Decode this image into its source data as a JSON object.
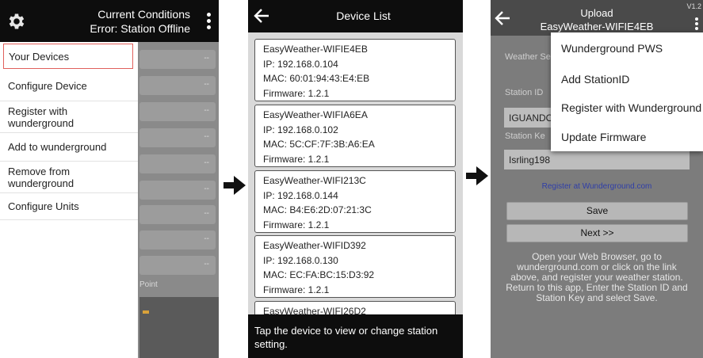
{
  "screen1": {
    "title_line1": "Current Conditions",
    "title_line2": "Error: Station Offline",
    "icons": [
      "gear-icon",
      "kebab-menu-icon"
    ],
    "drawer": {
      "items": [
        {
          "label": "Your Devices",
          "selected": true
        },
        {
          "label": "Configure Device",
          "selected": false
        },
        {
          "label": "Register with wunderground",
          "selected": false
        },
        {
          "label": "Add to wunderground",
          "selected": false
        },
        {
          "label": "Remove from wunderground",
          "selected": false
        },
        {
          "label": "Configure Units",
          "selected": false
        }
      ]
    },
    "background": {
      "row_value": "--",
      "partial_text": "Point"
    }
  },
  "screen2": {
    "title": "Device List",
    "icons": [
      "back-arrow-icon"
    ],
    "devices": [
      {
        "name": "EasyWeather-WIFIE4EB",
        "ip": "IP: 192.168.0.104",
        "mac": "MAC: 60:01:94:43:E4:EB",
        "firmware": "Firmware: 1.2.1"
      },
      {
        "name": "EasyWeather-WIFIA6EA",
        "ip": "IP: 192.168.0.102",
        "mac": "MAC: 5C:CF:7F:3B:A6:EA",
        "firmware": "Firmware: 1.2.1"
      },
      {
        "name": "EasyWeather-WIFI213C",
        "ip": "IP: 192.168.0.144",
        "mac": "MAC: B4:E6:2D:07:21:3C",
        "firmware": "Firmware: 1.2.1"
      },
      {
        "name": "EasyWeather-WIFID392",
        "ip": "IP: 192.168.0.130",
        "mac": "MAC: EC:FA:BC:15:D3:92",
        "firmware": "Firmware: 1.2.1"
      },
      {
        "name": "EasyWeather-WIFI26D2",
        "ip": "",
        "mac": "",
        "firmware": ""
      }
    ],
    "footer": "Tap the device to view or change station setting."
  },
  "screen3": {
    "title_line1": "Upload",
    "title_line2": "EasyWeather-WIFIE4EB",
    "version": "V1.2",
    "icons": [
      "back-arrow-icon",
      "kebab-menu-icon"
    ],
    "labels": {
      "weather_section": "Weather Se",
      "station_id": "Station ID",
      "station_key": "Station Ke"
    },
    "station_id_value": "IGUANDO",
    "station_key_value": "Isrling198",
    "register_link": "Register at Wunderground.com",
    "save_button": "Save",
    "next_button": "Next >>",
    "help_paragraph1": "Open your Web Browser, go to wunderground.com or click on the link above, and register your weather station.",
    "help_paragraph2": "Return to this app, Enter the Station ID and Station Key and select Save.",
    "popup_menu": [
      "Wunderground PWS",
      "Add StationID",
      "Register with Wunderground",
      "Update Firmware"
    ]
  },
  "colors": {
    "toolbar": "#0d0d0d",
    "selected_outline": "#e0605c",
    "link": "#2f3ea8",
    "list_background": "#d9d9d9"
  }
}
